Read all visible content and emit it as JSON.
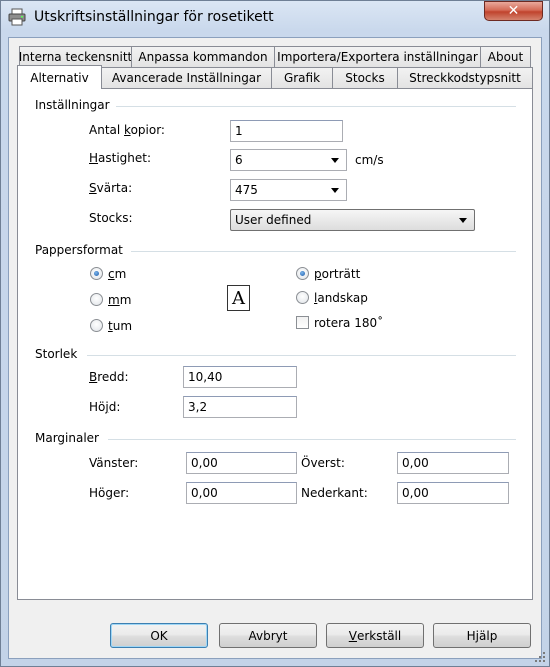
{
  "window": {
    "title": "Utskriftsinställningar för rosetikett",
    "close_label": "✕"
  },
  "tabs_row1": [
    {
      "label": "Interna teckensnitt"
    },
    {
      "label": "Anpassa kommandon"
    },
    {
      "label": "Importera/Exportera inställningar"
    },
    {
      "label": "About"
    }
  ],
  "tabs_row2": [
    {
      "label": "Alternativ",
      "active": true
    },
    {
      "label": "Avancerade Inställningar"
    },
    {
      "label": "Grafik"
    },
    {
      "label": "Stocks"
    },
    {
      "label": "Streckkodstypsnitt"
    }
  ],
  "settings": {
    "header": "Inställningar",
    "copies": {
      "label_pre": "Antal ",
      "label_u": "k",
      "label_post": "opior:",
      "value": "1"
    },
    "speed": {
      "label_u": "H",
      "label_post": "astighet:",
      "value": "6",
      "unit": "cm/s"
    },
    "darkness": {
      "label_u": "S",
      "label_post": "värta:",
      "value": "475"
    },
    "stocks": {
      "label": "Stocks:",
      "value": "User defined"
    }
  },
  "paper": {
    "header": "Pappersformat",
    "units": [
      {
        "label_u": "c",
        "label_post": "m",
        "selected": true
      },
      {
        "label_u": "m",
        "label_post": "m",
        "selected": false
      },
      {
        "label_u": "t",
        "label_post": "um",
        "selected": false
      }
    ],
    "orientation_icon_letter": "A",
    "portrait": {
      "label_u": "p",
      "label_post": "orträtt",
      "selected": true
    },
    "landscape": {
      "label_u": "l",
      "label_post": "andskap",
      "selected": false
    },
    "rotate": {
      "label": "rotera 180˚",
      "checked": false
    }
  },
  "size": {
    "header": "Storlek",
    "width": {
      "label_u": "B",
      "label_post": "redd:",
      "value": "10,40"
    },
    "height": {
      "label_pre": "Hö",
      "label_u": "j",
      "label_post": "d:",
      "value": "3,2"
    }
  },
  "margins": {
    "header": "Marginaler",
    "left": {
      "label": "Vänster:",
      "value": "0,00"
    },
    "top": {
      "label": "Överst:",
      "value": "0,00"
    },
    "right": {
      "label": "Höger:",
      "value": "0,00"
    },
    "bottom": {
      "label": "Nederkant:",
      "value": "0,00"
    }
  },
  "buttons": {
    "ok": "OK",
    "cancel": "Avbryt",
    "apply_u": "V",
    "apply_post": "erkställ",
    "help": "Hjälp"
  }
}
